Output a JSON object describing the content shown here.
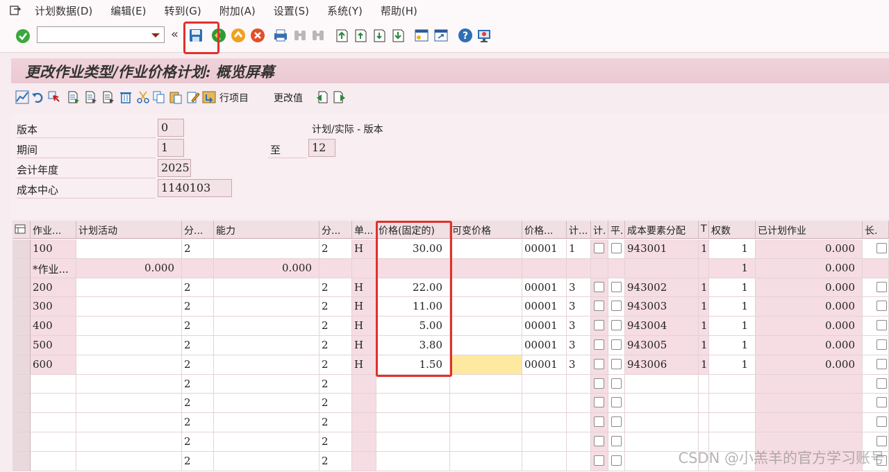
{
  "menu": [
    "计划数据(D)",
    "编辑(E)",
    "转到(G)",
    "附加(A)",
    "设置(S)",
    "系统(Y)",
    "帮助(H)"
  ],
  "toolbar": {
    "command_value": "",
    "collapse_glyph": "«",
    "icons": [
      "enter-icon",
      "save-icon",
      "back-icon",
      "exit-icon",
      "cancel-icon",
      "print-icon",
      "find-icon",
      "find-next-icon",
      "first-page-icon",
      "previous-page-icon",
      "next-page-icon",
      "last-page-icon",
      "create-session-icon",
      "shortcut-icon",
      "help-icon",
      "customize-layout-icon"
    ]
  },
  "title": "更改作业类型/作业价格计划: 概览屏幕",
  "app_toolbar": {
    "line_items": "行项目",
    "change_values": "更改值"
  },
  "header": {
    "version_label": "版本",
    "version_value": "0",
    "version_desc": "计划/实际 - 版本",
    "period_label": "期间",
    "period_from": "1",
    "period_to_label": "至",
    "period_to": "12",
    "fiscal_year_label": "会计年度",
    "fiscal_year_value": "2025",
    "cost_center_label": "成本中心",
    "cost_center_value": "1140103"
  },
  "table": {
    "columns": [
      "作业...",
      "计划活动",
      "分...",
      "能力",
      "分...",
      "单...",
      "价格(固定的)",
      "可变价格",
      "价格...",
      "计...",
      "计.",
      "平.",
      "成本要素分配",
      "T",
      "权数",
      "已计划作业",
      "长."
    ],
    "rows": [
      {
        "act": "100",
        "plan": "",
        "d1": "2",
        "cap": "",
        "d2": "2",
        "unit": "H",
        "fixed": "30.00",
        "var": "",
        "pu": "00001",
        "pi": "1",
        "ce": "943001",
        "t": "1",
        "weight": "1",
        "planned": "0.000"
      },
      {
        "act": "*作业...",
        "plan": "0.000",
        "d1": "",
        "cap": "0.000",
        "d2": "",
        "unit": "",
        "fixed": "",
        "var": "",
        "pu": "",
        "pi": "",
        "ce": "",
        "t": "",
        "weight": "1",
        "planned": "0.000"
      },
      {
        "act": "200",
        "plan": "",
        "d1": "2",
        "cap": "",
        "d2": "2",
        "unit": "H",
        "fixed": "22.00",
        "var": "",
        "pu": "00001",
        "pi": "3",
        "ce": "943002",
        "t": "1",
        "weight": "1",
        "planned": "0.000"
      },
      {
        "act": "300",
        "plan": "",
        "d1": "2",
        "cap": "",
        "d2": "2",
        "unit": "H",
        "fixed": "11.00",
        "var": "",
        "pu": "00001",
        "pi": "3",
        "ce": "943003",
        "t": "1",
        "weight": "1",
        "planned": "0.000"
      },
      {
        "act": "400",
        "plan": "",
        "d1": "2",
        "cap": "",
        "d2": "2",
        "unit": "H",
        "fixed": "5.00",
        "var": "",
        "pu": "00001",
        "pi": "3",
        "ce": "943004",
        "t": "1",
        "weight": "1",
        "planned": "0.000"
      },
      {
        "act": "500",
        "plan": "",
        "d1": "2",
        "cap": "",
        "d2": "2",
        "unit": "H",
        "fixed": "3.80",
        "var": "",
        "pu": "00001",
        "pi": "3",
        "ce": "943005",
        "t": "1",
        "weight": "1",
        "planned": "0.000"
      },
      {
        "act": "600",
        "plan": "",
        "d1": "2",
        "cap": "",
        "d2": "2",
        "unit": "H",
        "fixed": "1.50",
        "var": "",
        "pu": "00001",
        "pi": "3",
        "ce": "943006",
        "t": "1",
        "weight": "1",
        "planned": "0.000"
      },
      {
        "act": "",
        "plan": "",
        "d1": "2",
        "cap": "",
        "d2": "2",
        "unit": "",
        "fixed": "",
        "var": "",
        "pu": "",
        "pi": "",
        "ce": "",
        "t": "",
        "weight": "",
        "planned": ""
      },
      {
        "act": "",
        "plan": "",
        "d1": "2",
        "cap": "",
        "d2": "2",
        "unit": "",
        "fixed": "",
        "var": "",
        "pu": "",
        "pi": "",
        "ce": "",
        "t": "",
        "weight": "",
        "planned": ""
      },
      {
        "act": "",
        "plan": "",
        "d1": "2",
        "cap": "",
        "d2": "2",
        "unit": "",
        "fixed": "",
        "var": "",
        "pu": "",
        "pi": "",
        "ce": "",
        "t": "",
        "weight": "",
        "planned": ""
      },
      {
        "act": "",
        "plan": "",
        "d1": "2",
        "cap": "",
        "d2": "2",
        "unit": "",
        "fixed": "",
        "var": "",
        "pu": "",
        "pi": "",
        "ce": "",
        "t": "",
        "weight": "",
        "planned": ""
      },
      {
        "act": "",
        "plan": "",
        "d1": "2",
        "cap": "",
        "d2": "2",
        "unit": "",
        "fixed": "",
        "var": "",
        "pu": "",
        "pi": "",
        "ce": "",
        "t": "",
        "weight": "",
        "planned": ""
      }
    ]
  },
  "watermark": "CSDN @小羔羊的官方学习账号",
  "colors": {
    "highlight": "#e0302c",
    "header_pink": "#ecc9d2",
    "input_yellow": "#fdeaa0"
  }
}
